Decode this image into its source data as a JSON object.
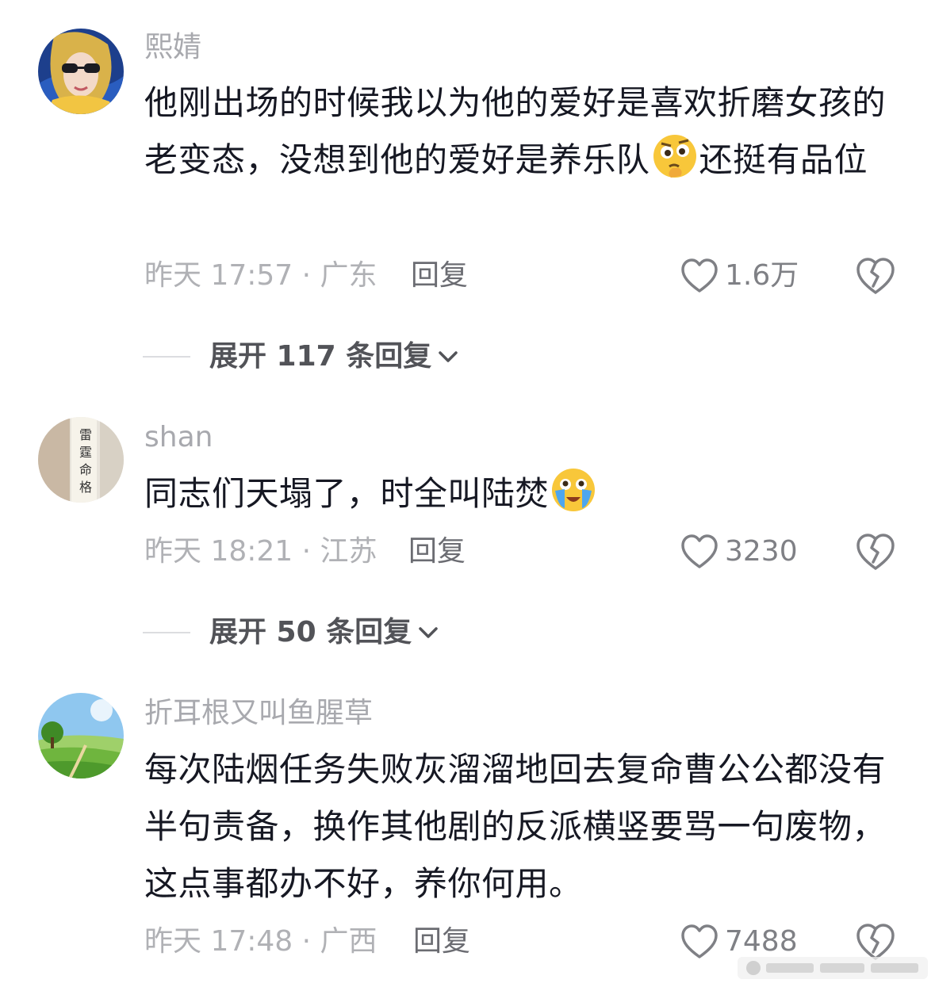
{
  "comments": [
    {
      "username": "熙婧",
      "content_parts": [
        "他刚出场的时候我以为他的爱好是喜欢折磨女孩的老变态，没想到他的爱好是养乐队",
        "还挺有品位"
      ],
      "emoji": "thinking-face-emoji",
      "time_location": "昨天 17:57 · 广东",
      "reply_label": "回复",
      "like_count": "1.6万",
      "replies_expand_label": "展开 117 条回复"
    },
    {
      "username": "shan",
      "content_parts": [
        "同志们天塌了，时全叫陆焚",
        ""
      ],
      "emoji": "crying-face-emoji",
      "time_location": "昨天 18:21 · 江苏",
      "reply_label": "回复",
      "like_count": "3230",
      "replies_expand_label": "展开 50 条回复"
    },
    {
      "username": "折耳根又叫鱼腥草",
      "content": "每次陆烟任务失败灰溜溜地回去复命曹公公都没有半句责备，换作其他剧的反派横竖要骂一句废物，这点事都办不好，养你何用。",
      "time_location": "昨天 17:48 · 广西",
      "reply_label": "回复",
      "like_count": "7488"
    }
  ],
  "icons": {
    "like": "heart-outline-icon",
    "dislike": "broken-heart-icon",
    "expand": "chevron-down-icon"
  },
  "colors": {
    "text_primary": "#161823",
    "text_secondary": "#a8a9ae",
    "reply_text": "#6b6c72"
  }
}
